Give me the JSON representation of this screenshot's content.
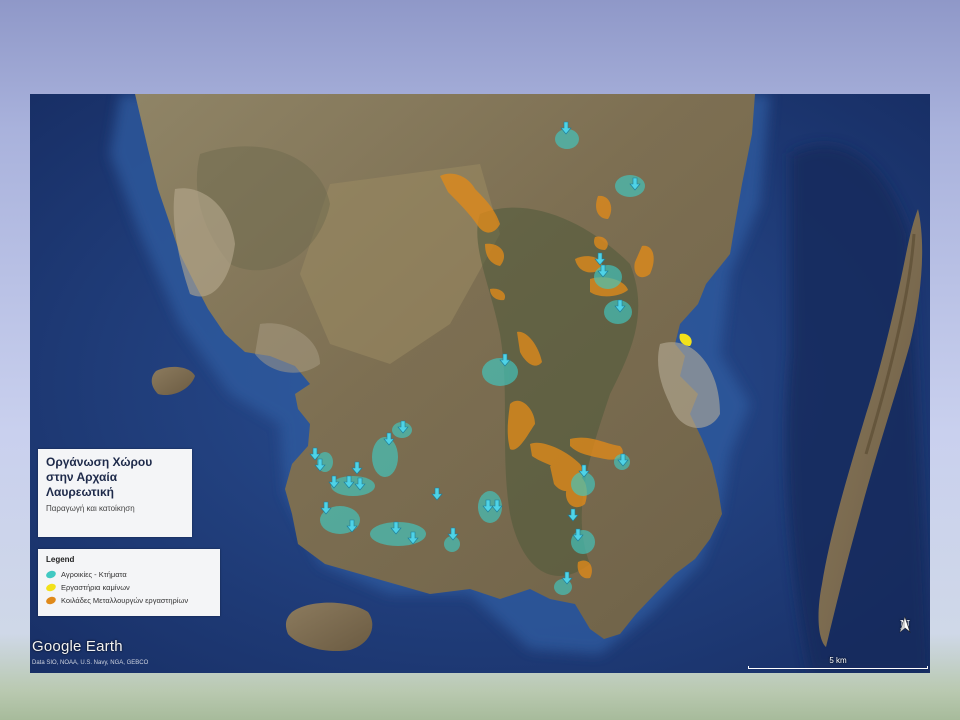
{
  "title": {
    "main": "Οργάνωση Χώρου στην Αρχαία Λαυρεωτική",
    "subtitle": "Παραγωγή και κατοίκηση"
  },
  "legend": {
    "title": "Legend",
    "items": [
      {
        "label": "Αγροικίες - Κτήματα",
        "color": "#41c9c2"
      },
      {
        "label": "Εργαστήρια καμίνων",
        "color": "#f2e11a"
      },
      {
        "label": "Κοιλάδες Μεταλλουργών εργαστηρίων",
        "color": "#e08a1a"
      }
    ]
  },
  "map_source": {
    "logo": "Google Earth",
    "credit": "Data SIO, NOAA, U.S. Navy, NGA, GEBCO"
  },
  "scale_bar": {
    "label": "5 km"
  },
  "north_arrow": {
    "label": "N"
  },
  "colors": {
    "sea": "#1e3a78",
    "land": "#8a7a5a",
    "farmstead": "#41c9c2",
    "marker": "#4fd3e6",
    "furnace": "#f2e11a",
    "valley": "#e08a1a"
  }
}
